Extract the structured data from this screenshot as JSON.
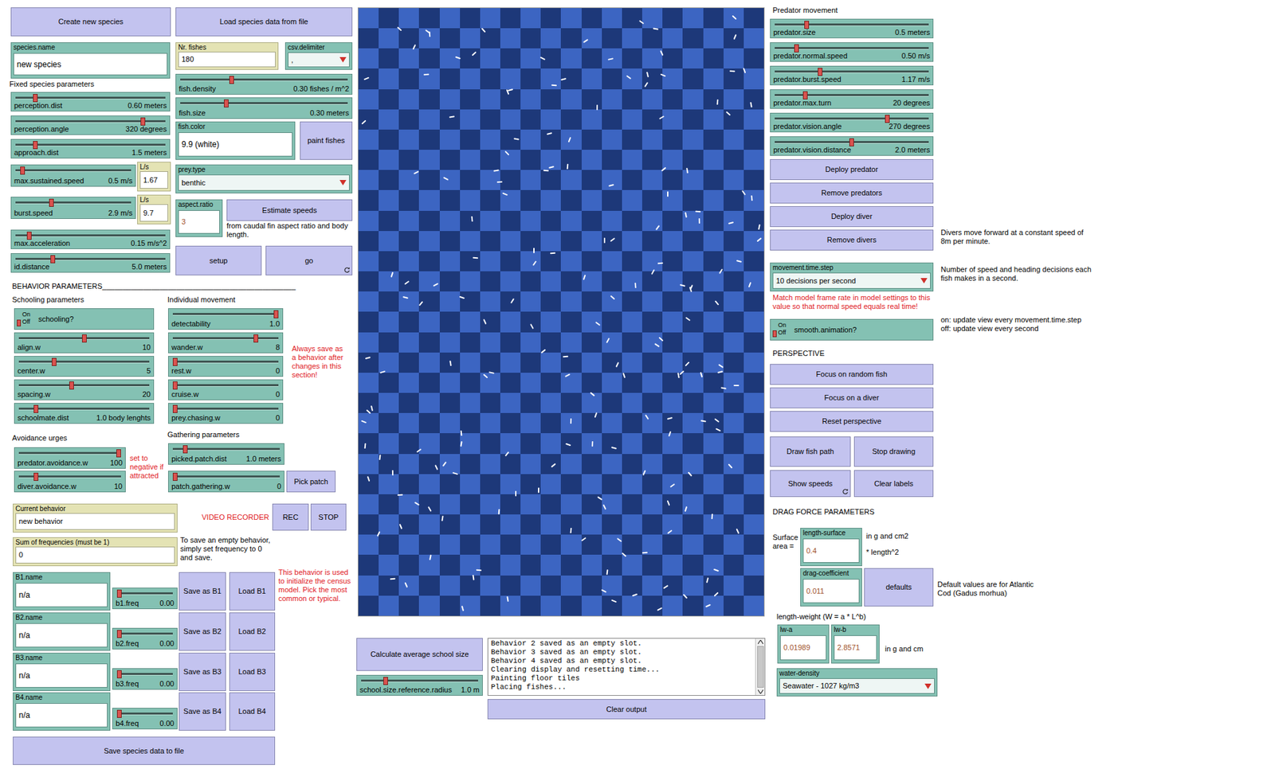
{
  "widgets": [
    {
      "kind": "button",
      "label": "Create new species",
      "forever": false
    },
    {
      "kind": "button",
      "label": "Load species data from file",
      "forever": false
    },
    {
      "kind": "input",
      "label": "species.name",
      "value": "new species"
    },
    {
      "kind": "monitor",
      "label": "Nr. fishes",
      "value": "180"
    },
    {
      "kind": "chooser",
      "label": "csv.delimiter",
      "value": ","
    },
    {
      "kind": "slider",
      "label": "perception.dist",
      "reading": "0.60 meters",
      "level": 0.12
    },
    {
      "kind": "slider",
      "label": "perception.angle",
      "reading": "320 degrees",
      "level": 0.86
    },
    {
      "kind": "slider",
      "label": "approach.dist",
      "reading": "1.5 meters",
      "level": 0.12
    },
    {
      "kind": "slider",
      "label": "max.sustained.speed",
      "reading": "0.5 m/s",
      "level": 0.04
    },
    {
      "kind": "monitor",
      "label": "L/s",
      "value": "1.67"
    },
    {
      "kind": "slider",
      "label": "burst.speed",
      "reading": "2.9 m/s",
      "level": 0.3
    },
    {
      "kind": "monitor",
      "label": "L/s",
      "value": "9.7"
    },
    {
      "kind": "slider",
      "label": "max.acceleration",
      "reading": "0.15 m/s^2",
      "level": 0.08
    },
    {
      "kind": "slider",
      "label": "id.distance",
      "reading": "5.0 meters",
      "level": 0.24
    },
    {
      "kind": "slider",
      "label": "fish.density",
      "reading": "0.30 fishes / m^2",
      "level": 0.3
    },
    {
      "kind": "slider",
      "label": "fish.size",
      "reading": "0.30 meters",
      "level": 0.27
    },
    {
      "kind": "input",
      "label": "fish.color",
      "value": "9.9 (white)"
    },
    {
      "kind": "button",
      "label": "paint fishes",
      "forever": false
    },
    {
      "kind": "chooser",
      "label": "prey.type",
      "value": "benthic"
    },
    {
      "kind": "number-input",
      "label": "aspect.ratio",
      "value": "3"
    },
    {
      "kind": "button",
      "label": "Estimate speeds",
      "forever": false
    },
    {
      "kind": "button",
      "label": "setup",
      "forever": false
    },
    {
      "kind": "button",
      "label": "go",
      "forever": true
    },
    {
      "kind": "switch",
      "label": "schooling?",
      "on_label": "On",
      "off_label": "Off",
      "on": false
    },
    {
      "kind": "slider",
      "label": "align.w",
      "reading": "10",
      "level": 0.5
    },
    {
      "kind": "slider",
      "label": "center.w",
      "reading": "5",
      "level": 0.26
    },
    {
      "kind": "slider",
      "label": "spacing.w",
      "reading": "20",
      "level": 0.4
    },
    {
      "kind": "slider",
      "label": "schoolmate.dist",
      "reading": "1.0 body lenghts",
      "level": 0.12
    },
    {
      "kind": "slider",
      "label": "detectability",
      "reading": "1.0",
      "level": 1
    },
    {
      "kind": "slider",
      "label": "wander.w",
      "reading": "8",
      "level": 0.8
    },
    {
      "kind": "slider",
      "label": "rest.w",
      "reading": "0",
      "level": 0
    },
    {
      "kind": "slider",
      "label": "cruise.w",
      "reading": "0",
      "level": 0
    },
    {
      "kind": "slider",
      "label": "prey.chasing.w",
      "reading": "0",
      "level": 0
    },
    {
      "kind": "slider",
      "label": "predator.avoidance.w",
      "reading": "100",
      "level": 1
    },
    {
      "kind": "slider",
      "label": "diver.avoidance.w",
      "reading": "10",
      "level": 0.15
    },
    {
      "kind": "slider",
      "label": "picked.patch.dist",
      "reading": "1.0 meters",
      "level": 0.1
    },
    {
      "kind": "slider",
      "label": "patch.gathering.w",
      "reading": "0",
      "level": 0
    },
    {
      "kind": "button",
      "label": "Pick patch",
      "forever": false
    },
    {
      "kind": "monitor",
      "label": "Current behavior",
      "value": "new behavior"
    },
    {
      "kind": "button",
      "label": "REC",
      "forever": false
    },
    {
      "kind": "button",
      "label": "STOP",
      "forever": false
    },
    {
      "kind": "monitor",
      "label": "Sum of frequencies (must be 1)",
      "value": "0"
    },
    {
      "kind": "input",
      "label": "B1.name",
      "value": "n/a"
    },
    {
      "kind": "slider",
      "label": "b1.freq",
      "reading": "0.00",
      "level": 0
    },
    {
      "kind": "button",
      "label": "Save as B1",
      "forever": false
    },
    {
      "kind": "button",
      "label": "Load B1",
      "forever": false
    },
    {
      "kind": "input",
      "label": "B2.name",
      "value": "n/a"
    },
    {
      "kind": "slider",
      "label": "b2.freq",
      "reading": "0.00",
      "level": 0
    },
    {
      "kind": "button",
      "label": "Save as B2",
      "forever": false
    },
    {
      "kind": "button",
      "label": "Load B2",
      "forever": false
    },
    {
      "kind": "input",
      "label": "B3.name",
      "value": "n/a"
    },
    {
      "kind": "slider",
      "label": "b3.freq",
      "reading": "0.00",
      "level": 0
    },
    {
      "kind": "button",
      "label": "Save as B3",
      "forever": false
    },
    {
      "kind": "button",
      "label": "Load B3",
      "forever": false
    },
    {
      "kind": "input",
      "label": "B4.name",
      "value": "n/a"
    },
    {
      "kind": "slider",
      "label": "b4.freq",
      "reading": "0.00",
      "level": 0
    },
    {
      "kind": "button",
      "label": "Save as B4",
      "forever": false
    },
    {
      "kind": "button",
      "label": "Load B4",
      "forever": false
    },
    {
      "kind": "button",
      "label": "Save species data to file",
      "forever": false
    },
    {
      "kind": "button",
      "label": "Calculate average school size",
      "forever": false
    },
    {
      "kind": "slider",
      "label": "school.size.reference.radius",
      "reading": "1.0 m",
      "level": 0.2
    },
    {
      "kind": "button",
      "label": "Clear output",
      "forever": false
    },
    {
      "kind": "slider",
      "label": "predator.size",
      "reading": "0.5 meters",
      "level": 0.2
    },
    {
      "kind": "slider",
      "label": "predator.normal.speed",
      "reading": "0.50 m/s",
      "level": 0.13
    },
    {
      "kind": "slider",
      "label": "predator.burst.speed",
      "reading": "1.17 m/s",
      "level": 0.29
    },
    {
      "kind": "slider",
      "label": "predator.max.turn",
      "reading": "20 degrees",
      "level": 0.19
    },
    {
      "kind": "slider",
      "label": "predator.vision.angle",
      "reading": "270 degrees",
      "level": 0.74
    },
    {
      "kind": "slider",
      "label": "predator.vision.distance",
      "reading": "2.0 meters",
      "level": 0.5
    },
    {
      "kind": "button",
      "label": "Deploy predator",
      "forever": false
    },
    {
      "kind": "button",
      "label": "Remove predators",
      "forever": false
    },
    {
      "kind": "button",
      "label": "Deploy diver",
      "forever": false
    },
    {
      "kind": "button",
      "label": "Remove divers",
      "forever": false
    },
    {
      "kind": "chooser",
      "label": "movement.time.step",
      "value": "10 decisions per second"
    },
    {
      "kind": "switch",
      "label": "smooth.animation?",
      "on_label": "On",
      "off_label": "Off",
      "on": false
    },
    {
      "kind": "button",
      "label": "Focus on random fish",
      "forever": false
    },
    {
      "kind": "button",
      "label": "Focus on a diver",
      "forever": false
    },
    {
      "kind": "button",
      "label": "Reset perspective",
      "forever": false
    },
    {
      "kind": "button",
      "label": "Draw fish path",
      "forever": false
    },
    {
      "kind": "button",
      "label": "Stop drawing",
      "forever": false
    },
    {
      "kind": "button",
      "label": "Show speeds",
      "forever": true
    },
    {
      "kind": "button",
      "label": "Clear labels",
      "forever": false
    },
    {
      "kind": "number-input",
      "label": "length-surface",
      "value": "0.4"
    },
    {
      "kind": "number-input",
      "label": "drag-coefficient",
      "value": "0.011"
    },
    {
      "kind": "button",
      "label": "defaults",
      "forever": false
    },
    {
      "kind": "number-input",
      "label": "lw-a",
      "value": "0.01989"
    },
    {
      "kind": "number-input",
      "label": "lw-b",
      "value": "2.8571"
    },
    {
      "kind": "chooser",
      "label": "water-density",
      "value": "Seawater - 1027 kg/m3"
    }
  ],
  "notes": [
    {
      "text": "Fixed species parameters",
      "color": "#000000"
    },
    {
      "text": "from caudal fin aspect ratio and body length.",
      "color": "#000000"
    },
    {
      "text": "BEHAVIOR PARAMETERS_______________________________________________",
      "color": "#000000"
    },
    {
      "text": "Schooling parameters",
      "color": "#000000"
    },
    {
      "text": "Individual movement",
      "color": "#000000"
    },
    {
      "text": "Always save as a behavior after changes in this section!",
      "color": "#e0201e"
    },
    {
      "text": "Avoidance urges",
      "color": "#000000"
    },
    {
      "text": "set to negative if attracted",
      "color": "#e0201e"
    },
    {
      "text": "Gathering parameters",
      "color": "#000000"
    },
    {
      "text": "VIDEO RECORDER",
      "color": "#e0201e"
    },
    {
      "text": "To save an empty behavior, simply set frequency to 0 and save.",
      "color": "#000000"
    },
    {
      "text": "This behavior is used to initialize the census model. Pick the most common or typical.",
      "color": "#e0201e"
    },
    {
      "text": "Predator movement",
      "color": "#000000"
    },
    {
      "text": "Divers move forward at a constant speed of 8m per minute.",
      "color": "#000000"
    },
    {
      "text": "Number of speed and heading decisions each fish makes in a second.",
      "color": "#000000"
    },
    {
      "text": "Match model frame rate in model settings to this value so that normal speed equals real time!",
      "color": "#e0201e"
    },
    {
      "text": "on: update view every movement.time.step\noff: update view every second",
      "color": "#000000"
    },
    {
      "text": "PERSPECTIVE",
      "color": "#000000"
    },
    {
      "text": "DRAG FORCE PARAMETERS",
      "color": "#000000"
    },
    {
      "text": "Surface\narea =",
      "color": "#000000"
    },
    {
      "text": "in g and cm2",
      "color": "#000000"
    },
    {
      "text": "* length^2",
      "color": "#000000"
    },
    {
      "text": "Default values are for Atlantic Cod (Gadus morhua)",
      "color": "#000000"
    },
    {
      "text": "length-weight (W = a * L^b)",
      "color": "#000000"
    },
    {
      "text": "in g and cm",
      "color": "#000000"
    }
  ],
  "output": {
    "lines": [
      "Behavior 2 saved as an empty slot.",
      "Behavior 3 saved as an empty slot.",
      "Behavior 4 saved as an empty slot.",
      "Clearing display and resetting time...",
      "Painting floor tiles",
      "Placing fishes..."
    ]
  }
}
